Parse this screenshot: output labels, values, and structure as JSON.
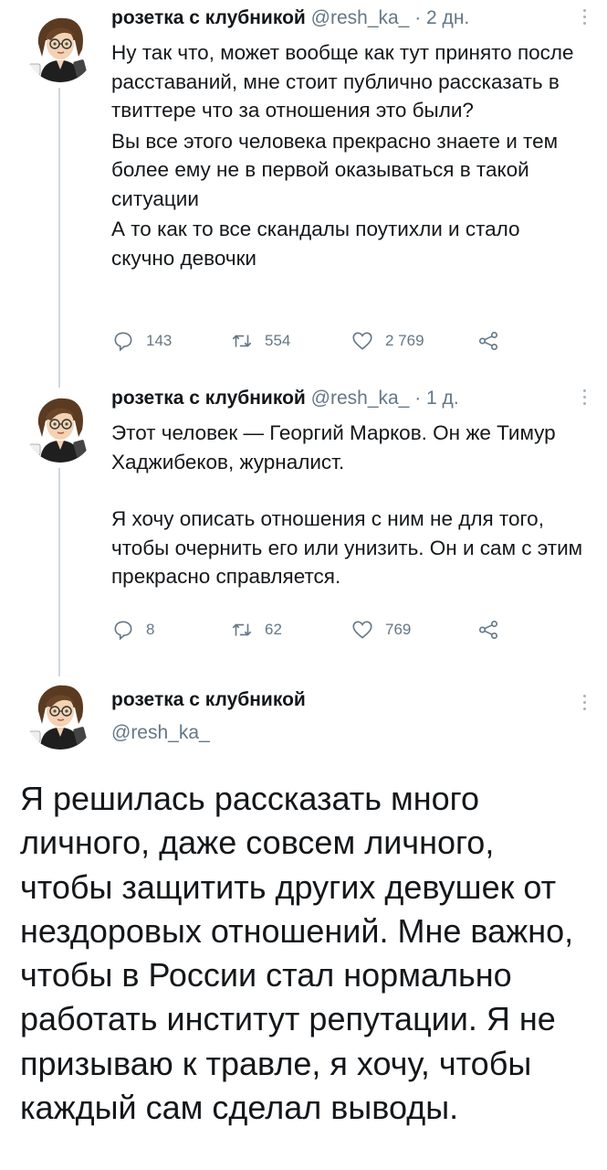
{
  "tweets": [
    {
      "name": "розетка с клубникой",
      "handle": "@resh_ka_",
      "time": "· 2 дн.",
      "paragraphs": [
        "Ну так что, может вообще как тут принято после расставаний, мне стоит публично рассказать в твиттере что за отношения это были?",
        "Вы все этого человека прекрасно знаете и тем более ему не в первой оказываться в такой ситуации",
        "А то как то все скандалы поутихли и стало скучно девочки"
      ],
      "replies": "143",
      "retweets": "554",
      "likes": "2 769"
    },
    {
      "name": "розетка с клубникой",
      "handle": "@resh_ka_",
      "time": "· 1 д.",
      "paragraphs": [
        "Этот человек — Георгий Марков. Он же Тимур Хаджибеков, журналист.",
        "Я хочу описать отношения с ним не для того, чтобы очернить его или унизить. Он и сам с этим прекрасно справляется."
      ],
      "replies": "8",
      "retweets": "62",
      "likes": "769"
    },
    {
      "name": "розетка с клубникой",
      "handle": "@resh_ka_",
      "text": "Я решилась рассказать много личного, даже совсем личного, чтобы защитить других девушек от нездоровых отношений. Мне важно, чтобы в России стал нормально работать институт репутации. Я не призываю к травле, я хочу, чтобы каждый сам сделал выводы."
    }
  ],
  "icons": {
    "reply": "reply-icon",
    "retweet": "retweet-icon",
    "like": "heart-icon",
    "share": "share-icon",
    "more": "more-icon",
    "avatar": "avatar-image"
  },
  "colors": {
    "text": "#14171a",
    "muted": "#657786",
    "thread_line": "#cfd9de"
  }
}
